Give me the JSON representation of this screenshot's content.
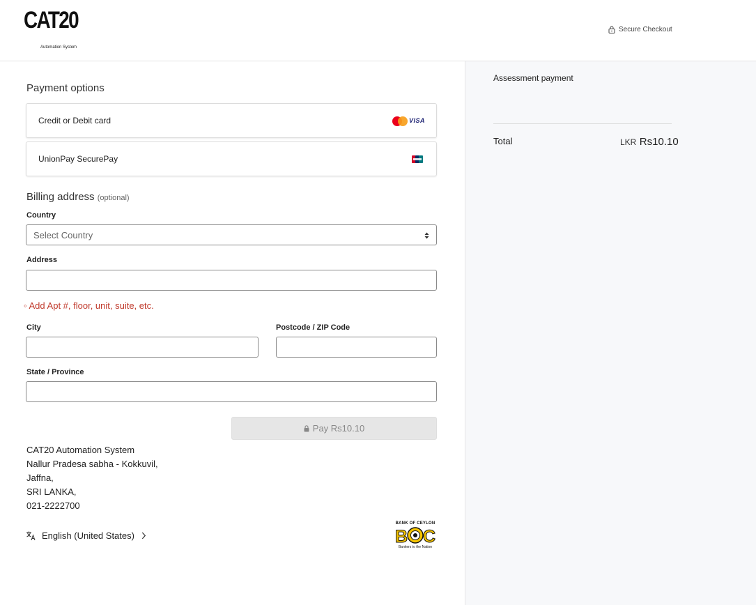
{
  "header": {
    "logo_text": "CAT20",
    "logo_subtext": "Automation System",
    "secure_label": "Secure Checkout"
  },
  "payment": {
    "title": "Payment options",
    "options": [
      {
        "label": "Credit or Debit card",
        "icons": [
          "mastercard-icon",
          "visa-icon"
        ]
      },
      {
        "label": "UnionPay SecurePay",
        "icons": [
          "unionpay-icon"
        ]
      }
    ]
  },
  "billing": {
    "title": "Billing address",
    "optional": "(optional)",
    "country_label": "Country",
    "country_placeholder": "Select Country",
    "address_label": "Address",
    "address_hint": "Add Apt #, floor, unit, suite, etc.",
    "city_label": "City",
    "postcode_label": "Postcode / ZIP Code",
    "state_label": "State / Province"
  },
  "pay_button": {
    "label": "Pay Rs10.10"
  },
  "merchant": {
    "lines": [
      "CAT20 Automation System",
      "Nallur Pradesa sabha - Kokkuvil,",
      "Jaffna,",
      "SRI LANKA,",
      "021-2222700"
    ]
  },
  "language": {
    "label": "English (United States)"
  },
  "bank_logo": {
    "top": "BANK OF CEYLON",
    "mark": "BOC",
    "tagline": "Bankers to the Nation"
  },
  "summary": {
    "item": "Assessment payment",
    "total_label": "Total",
    "currency": "LKR",
    "amount": "Rs10.10"
  },
  "colors": {
    "hint": "#c0392b",
    "boc_yellow": "#f5c400",
    "panel_bg": "#f7f8fa"
  }
}
